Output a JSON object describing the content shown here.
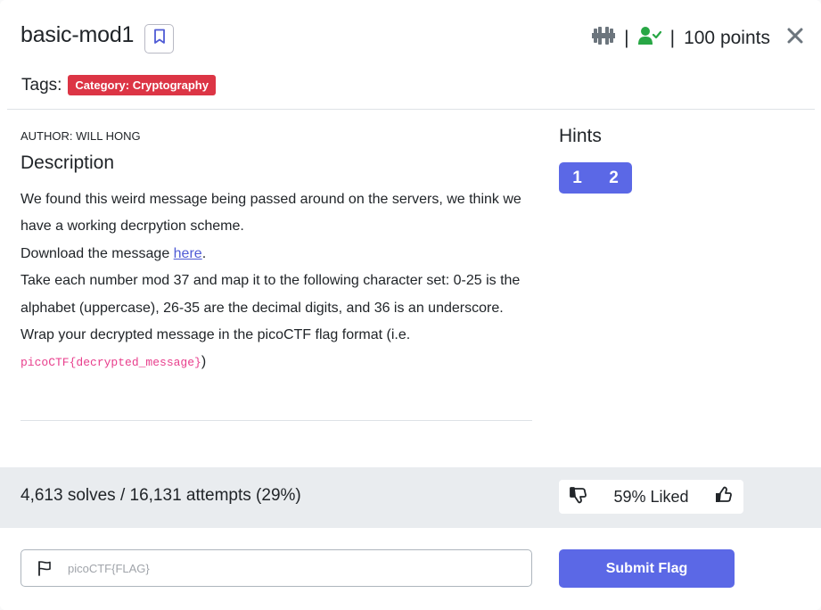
{
  "challenge": {
    "title": "basic-mod1",
    "points": "100 points",
    "meta_separator": "|"
  },
  "tags": {
    "label": "Tags:",
    "items": [
      "Category: Cryptography"
    ]
  },
  "description": {
    "author": "AUTHOR: WILL HONG",
    "heading": "Description",
    "para1": "We found this weird message being passed around on the servers, we think we have a working decrpytion scheme.",
    "download_prefix": "Download the message ",
    "download_link": "here",
    "download_suffix": ".",
    "para3": "Take each number mod 37 and map it to the following character set: 0-25 is the alphabet (uppercase), 26-35 are the decimal digits, and 36 is an underscore.",
    "para4_prefix": "Wrap your decrypted message in the picoCTF flag format (i.e. ",
    "para4_code": "picoCTF{decrypted_message}",
    "para4_suffix": ")"
  },
  "hints": {
    "heading": "Hints",
    "buttons": [
      "1",
      "2"
    ]
  },
  "stats": {
    "solves": "4,613 solves / 16,131 attempts (29%)",
    "liked": "59% Liked"
  },
  "flag_form": {
    "placeholder": "picoCTF{FLAG}",
    "value": "",
    "submit_label": "Submit Flag"
  },
  "icons": {
    "bookmark": "bookmark-icon",
    "difficulty": "dumbbell-icon",
    "solved": "user-check-icon",
    "close": "close-icon",
    "thumbs_down": "thumbs-down-icon",
    "thumbs_up": "thumbs-up-icon",
    "flag": "flag-icon"
  },
  "colors": {
    "accent": "#5b68e6",
    "tag_badge": "#dc3545",
    "solved_check": "#28a745",
    "code": "#e83e8c",
    "link": "#4f5bd5"
  }
}
